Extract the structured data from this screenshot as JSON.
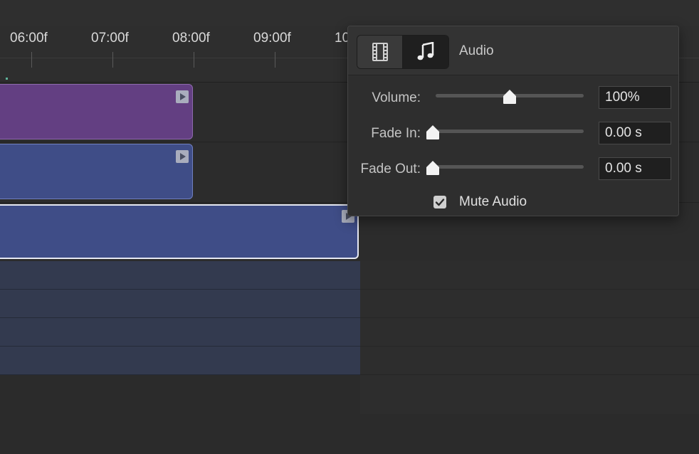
{
  "timeline": {
    "ruler_labels": [
      "06:00f",
      "07:00f",
      "08:00f",
      "09:00f",
      "10"
    ]
  },
  "audio_panel": {
    "tabs": [
      {
        "name": "video",
        "icon": "film-icon",
        "selected": false
      },
      {
        "name": "audio",
        "icon": "music-note-icon",
        "selected": true
      }
    ],
    "title": "Audio",
    "volume": {
      "label": "Volume:",
      "value": "100%",
      "level": 0.5
    },
    "fade_in": {
      "label": "Fade In:",
      "value": "0.00 s",
      "level": 0.0
    },
    "fade_out": {
      "label": "Fade Out:",
      "value": "0.00 s",
      "level": 0.0
    },
    "mute": {
      "label": "Mute Audio",
      "checked": true
    }
  },
  "colors": {
    "clip_purple": "#633f82",
    "clip_blue": "#3f4d87",
    "panel_bg": "#2e2e2e"
  }
}
